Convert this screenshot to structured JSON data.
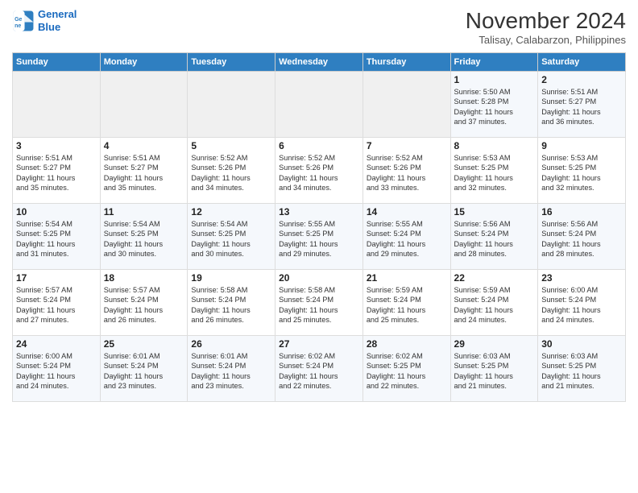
{
  "header": {
    "logo_line1": "General",
    "logo_line2": "Blue",
    "month": "November 2024",
    "location": "Talisay, Calabarzon, Philippines"
  },
  "weekdays": [
    "Sunday",
    "Monday",
    "Tuesday",
    "Wednesday",
    "Thursday",
    "Friday",
    "Saturday"
  ],
  "weeks": [
    [
      {
        "day": "",
        "info": ""
      },
      {
        "day": "",
        "info": ""
      },
      {
        "day": "",
        "info": ""
      },
      {
        "day": "",
        "info": ""
      },
      {
        "day": "",
        "info": ""
      },
      {
        "day": "1",
        "info": "Sunrise: 5:50 AM\nSunset: 5:28 PM\nDaylight: 11 hours\nand 37 minutes."
      },
      {
        "day": "2",
        "info": "Sunrise: 5:51 AM\nSunset: 5:27 PM\nDaylight: 11 hours\nand 36 minutes."
      }
    ],
    [
      {
        "day": "3",
        "info": "Sunrise: 5:51 AM\nSunset: 5:27 PM\nDaylight: 11 hours\nand 35 minutes."
      },
      {
        "day": "4",
        "info": "Sunrise: 5:51 AM\nSunset: 5:27 PM\nDaylight: 11 hours\nand 35 minutes."
      },
      {
        "day": "5",
        "info": "Sunrise: 5:52 AM\nSunset: 5:26 PM\nDaylight: 11 hours\nand 34 minutes."
      },
      {
        "day": "6",
        "info": "Sunrise: 5:52 AM\nSunset: 5:26 PM\nDaylight: 11 hours\nand 34 minutes."
      },
      {
        "day": "7",
        "info": "Sunrise: 5:52 AM\nSunset: 5:26 PM\nDaylight: 11 hours\nand 33 minutes."
      },
      {
        "day": "8",
        "info": "Sunrise: 5:53 AM\nSunset: 5:25 PM\nDaylight: 11 hours\nand 32 minutes."
      },
      {
        "day": "9",
        "info": "Sunrise: 5:53 AM\nSunset: 5:25 PM\nDaylight: 11 hours\nand 32 minutes."
      }
    ],
    [
      {
        "day": "10",
        "info": "Sunrise: 5:54 AM\nSunset: 5:25 PM\nDaylight: 11 hours\nand 31 minutes."
      },
      {
        "day": "11",
        "info": "Sunrise: 5:54 AM\nSunset: 5:25 PM\nDaylight: 11 hours\nand 30 minutes."
      },
      {
        "day": "12",
        "info": "Sunrise: 5:54 AM\nSunset: 5:25 PM\nDaylight: 11 hours\nand 30 minutes."
      },
      {
        "day": "13",
        "info": "Sunrise: 5:55 AM\nSunset: 5:25 PM\nDaylight: 11 hours\nand 29 minutes."
      },
      {
        "day": "14",
        "info": "Sunrise: 5:55 AM\nSunset: 5:24 PM\nDaylight: 11 hours\nand 29 minutes."
      },
      {
        "day": "15",
        "info": "Sunrise: 5:56 AM\nSunset: 5:24 PM\nDaylight: 11 hours\nand 28 minutes."
      },
      {
        "day": "16",
        "info": "Sunrise: 5:56 AM\nSunset: 5:24 PM\nDaylight: 11 hours\nand 28 minutes."
      }
    ],
    [
      {
        "day": "17",
        "info": "Sunrise: 5:57 AM\nSunset: 5:24 PM\nDaylight: 11 hours\nand 27 minutes."
      },
      {
        "day": "18",
        "info": "Sunrise: 5:57 AM\nSunset: 5:24 PM\nDaylight: 11 hours\nand 26 minutes."
      },
      {
        "day": "19",
        "info": "Sunrise: 5:58 AM\nSunset: 5:24 PM\nDaylight: 11 hours\nand 26 minutes."
      },
      {
        "day": "20",
        "info": "Sunrise: 5:58 AM\nSunset: 5:24 PM\nDaylight: 11 hours\nand 25 minutes."
      },
      {
        "day": "21",
        "info": "Sunrise: 5:59 AM\nSunset: 5:24 PM\nDaylight: 11 hours\nand 25 minutes."
      },
      {
        "day": "22",
        "info": "Sunrise: 5:59 AM\nSunset: 5:24 PM\nDaylight: 11 hours\nand 24 minutes."
      },
      {
        "day": "23",
        "info": "Sunrise: 6:00 AM\nSunset: 5:24 PM\nDaylight: 11 hours\nand 24 minutes."
      }
    ],
    [
      {
        "day": "24",
        "info": "Sunrise: 6:00 AM\nSunset: 5:24 PM\nDaylight: 11 hours\nand 24 minutes."
      },
      {
        "day": "25",
        "info": "Sunrise: 6:01 AM\nSunset: 5:24 PM\nDaylight: 11 hours\nand 23 minutes."
      },
      {
        "day": "26",
        "info": "Sunrise: 6:01 AM\nSunset: 5:24 PM\nDaylight: 11 hours\nand 23 minutes."
      },
      {
        "day": "27",
        "info": "Sunrise: 6:02 AM\nSunset: 5:24 PM\nDaylight: 11 hours\nand 22 minutes."
      },
      {
        "day": "28",
        "info": "Sunrise: 6:02 AM\nSunset: 5:25 PM\nDaylight: 11 hours\nand 22 minutes."
      },
      {
        "day": "29",
        "info": "Sunrise: 6:03 AM\nSunset: 5:25 PM\nDaylight: 11 hours\nand 21 minutes."
      },
      {
        "day": "30",
        "info": "Sunrise: 6:03 AM\nSunset: 5:25 PM\nDaylight: 11 hours\nand 21 minutes."
      }
    ]
  ]
}
